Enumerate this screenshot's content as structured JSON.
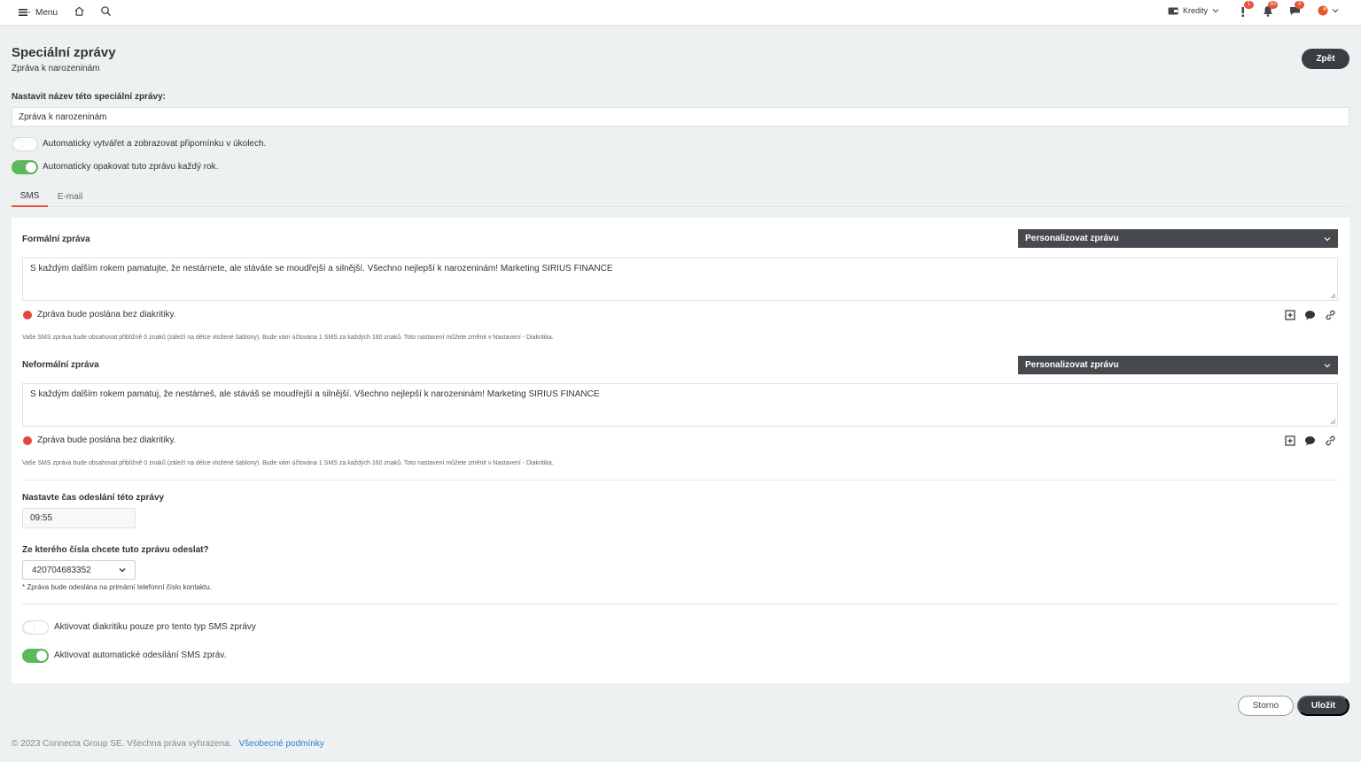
{
  "topbar": {
    "menu_label": "Menu",
    "credits_label": "Kredity",
    "badges": {
      "alerts": "1",
      "notifications": "30",
      "messages": "3"
    }
  },
  "header": {
    "title": "Speciální zprávy",
    "subtitle": "Zpráva k narozeninám",
    "back_label": "Zpět"
  },
  "name": {
    "label": "Nastavit název této speciální zprávy:",
    "value": "Zpráva k narozeninám"
  },
  "toggles": {
    "reminder": {
      "label": "Automaticky vytvářet a zobrazovat připomínku v úkolech.",
      "on": false
    },
    "repeat": {
      "label": "Automaticky opakovat tuto zprávu každý rok.",
      "on": true
    }
  },
  "tabs": [
    "SMS",
    "E-mail"
  ],
  "formal": {
    "label": "Formální zpráva",
    "personalize": "Personalizovat zprávu",
    "text": "S každým dalším rokem pamatujte, že nestárnete, ale stáváte se moudřejší a silnější. Všechno nejlepší k narozeninám! Marketing SIRIUS FINANCE",
    "warning": "Zpráva bude poslána bez diakritiky.",
    "note": "Vaše SMS zpráva bude obsahovat přibližně 0 znaků (záleží na délce vložené šablony). Bude vám účtována 1 SMS za každých 160 znaků. Toto nastavení můžete změnit v Nastavení - Diakritika."
  },
  "informal": {
    "label": "Neformální zpráva",
    "personalize": "Personalizovat zprávu",
    "text": "S každým dalším rokem pamatuj, že nestárneš, ale stáváš se moudřejší a silnější. Všechno nejlepší k narozeninám! Marketing SIRIUS FINANCE",
    "warning": "Zpráva bude poslána bez diakritiky.",
    "note": "Vaše SMS zpráva bude obsahovat přibližně 0 znaků (záleží na délce vložené šablony). Bude vám účtována 1 SMS za každých 160 znaků. Toto nastavení můžete změnit v Nastavení - Diakritika."
  },
  "time": {
    "label": "Nastavte čas odeslání této zprávy",
    "value": "09:55"
  },
  "sender": {
    "label": "Ze kterého čísla chcete tuto zprávu odeslat?",
    "selected": "420704683352",
    "note": "* Zpráva bude odeslána na primární telefonní číslo kontaktu."
  },
  "sms_toggles": {
    "diacritics": {
      "label": "Aktivovat diakritiku pouze pro tento typ SMS zprávy",
      "on": false
    },
    "auto_send": {
      "label": "Aktivovat automatické odesílání SMS zpráv.",
      "on": true
    }
  },
  "actions": {
    "cancel": "Storno",
    "save": "Uložit"
  },
  "footer": {
    "copyright": "© 2023 Connecta Group SE. Všechna práva vyhrazena.",
    "terms": "Všeobecné podmínky"
  },
  "colors": {
    "accent": "#e4563b",
    "toggle_on": "#5cb85c",
    "dark_button": "#3a3d41",
    "link": "#2a7ec9"
  }
}
